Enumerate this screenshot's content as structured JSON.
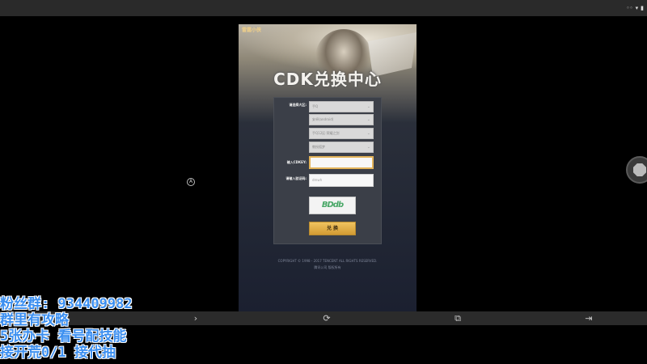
{
  "status_bar": {
    "icons": [
      "dots-icon",
      "wifi-icon",
      "battery-icon"
    ]
  },
  "left_marker": {
    "symbol": "A"
  },
  "game": {
    "logo_text": "雷霆小侠",
    "title": "CDK兑换中心",
    "form": {
      "server_label": "请选择大区:",
      "platform_select": {
        "value": "手Q"
      },
      "os_select": {
        "value": "安卓(android)"
      },
      "zone_select": {
        "value": "手Q12区·荣耀之剑"
      },
      "role_select": {
        "value": "教授孤梦"
      },
      "cdkey_label": "输入CDKEY:",
      "cdkey_input": {
        "value": ""
      },
      "captcha_label": "请输入验证码:",
      "captcha_input": {
        "placeholder": "dmwh"
      },
      "captcha_image_text": "BDdb",
      "submit_label": "兑 换"
    },
    "footer_lines": [
      "COPYRIGHT © 1998 - 2017 TENCENT ALL RIGHTS RESERVED.",
      "腾讯公司 版权所有"
    ]
  },
  "nav_bar": {
    "buttons": [
      "chevron-right-icon",
      "refresh-icon",
      "share-icon",
      "exit-icon"
    ]
  },
  "overlay": {
    "line1": "粉丝群: 934409982",
    "line2": "群里有攻略",
    "line3": "5张办卡 看号配技能",
    "line4": "接开荒0/1 接代抽"
  }
}
